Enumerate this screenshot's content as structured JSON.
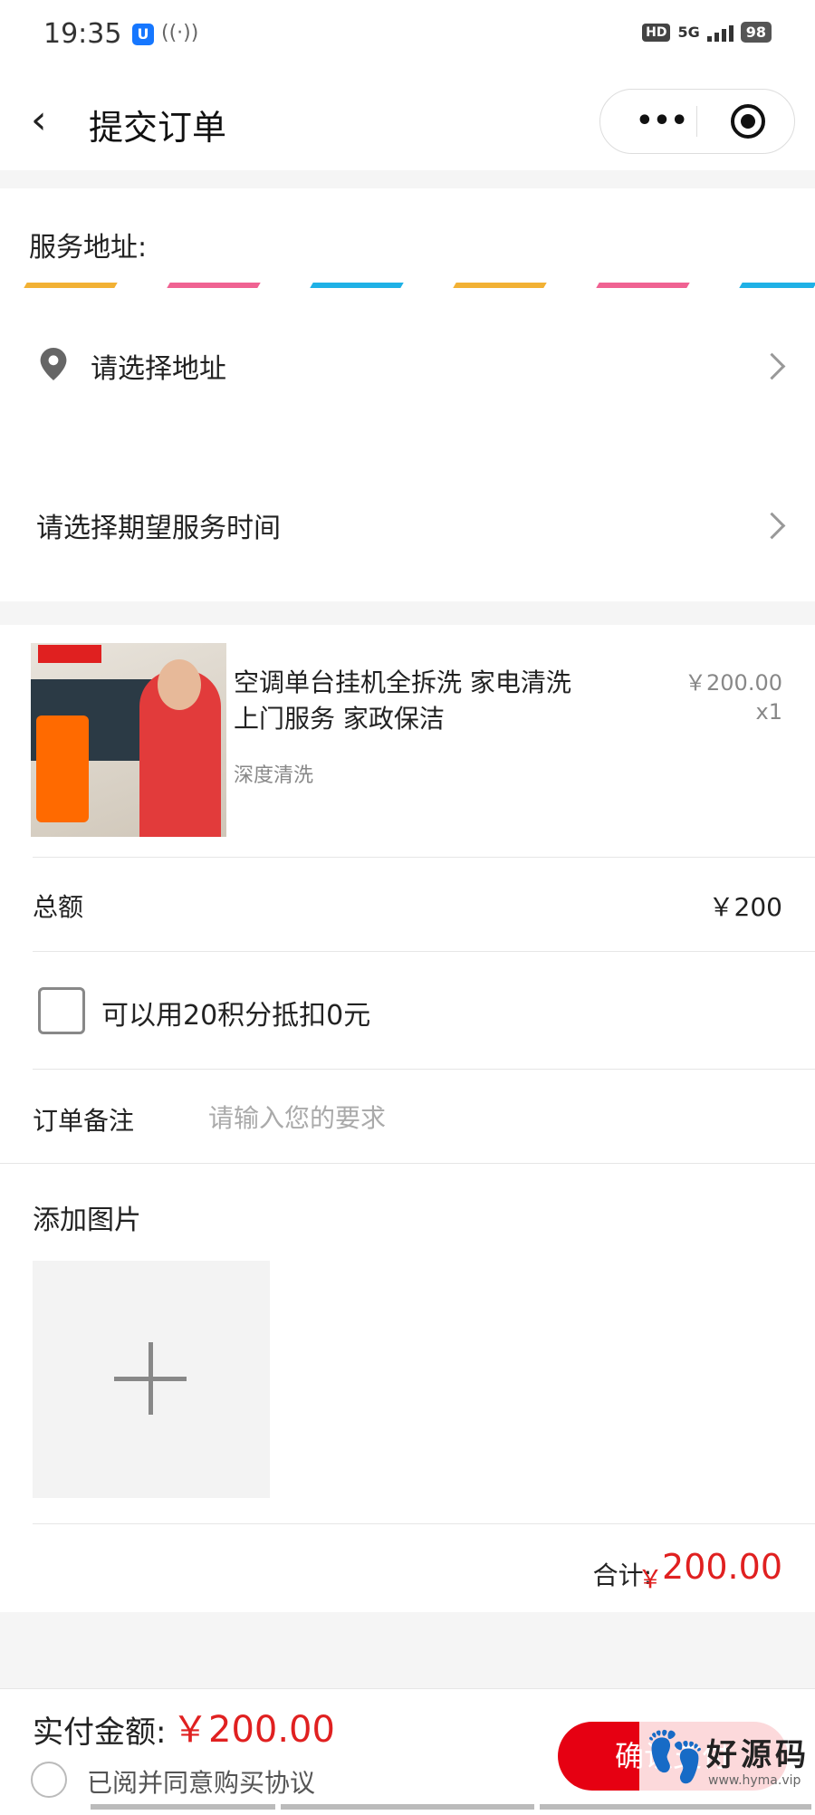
{
  "status_bar": {
    "time": "19:35",
    "hd": "HD",
    "network": "5G",
    "battery": "98"
  },
  "nav": {
    "back_icon": "chevron-left-icon",
    "title": "提交订单",
    "more_icon": "more-icon",
    "target_icon": "target-icon"
  },
  "address": {
    "label": "服务地址:",
    "stripe_colors": [
      "#f2b134",
      "#f06292",
      "#1fb1e6",
      "#f2b134",
      "#f06292",
      "#1fb1e6"
    ],
    "select_address": "请选择地址",
    "select_time": "请选择期望服务时间"
  },
  "product": {
    "name": "空调单台挂机全拆洗 家电清洗 上门服务 家政保洁",
    "sku": "深度清洗",
    "price": "￥200.00",
    "qty": "x1"
  },
  "order": {
    "total_label": "总额",
    "total_value": "￥200",
    "points_text": "可以用20积分抵扣0元",
    "points_checked": false,
    "remark_label": "订单备注",
    "remark_placeholder": "请输入您的要求",
    "remark_value": "",
    "add_picture_label": "添加图片",
    "sum_label": "合计:",
    "sum_currency": "￥",
    "sum_value": "200.00"
  },
  "bottom_bar": {
    "pay_label": "实付金额:",
    "pay_value": "￥200.00",
    "agree_text": "已阅并同意购买协议",
    "agree_checked": false,
    "confirm_label": "确认支付",
    "watermark_text": "好源码",
    "watermark_url": "www.hyma.vip"
  },
  "colors": {
    "accent_red": "#e02020",
    "confirm_red": "#e60012"
  }
}
